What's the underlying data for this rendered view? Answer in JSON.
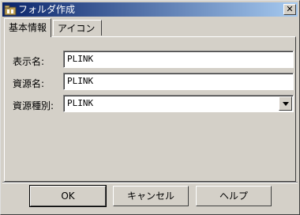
{
  "window": {
    "title": "フォルダ作成",
    "close_label": "✕"
  },
  "tabs": [
    {
      "label": "基本情報",
      "active": true
    },
    {
      "label": "アイコン",
      "active": false
    }
  ],
  "form": {
    "display_name": {
      "label": "表示名:",
      "value": "PLINK"
    },
    "resource_name": {
      "label": "資源名:",
      "value": "PLINK"
    },
    "resource_type": {
      "label": "資源種別:",
      "value": "PLINK"
    }
  },
  "buttons": {
    "ok": "OK",
    "cancel": "キャンセル",
    "help": "ヘルプ"
  }
}
